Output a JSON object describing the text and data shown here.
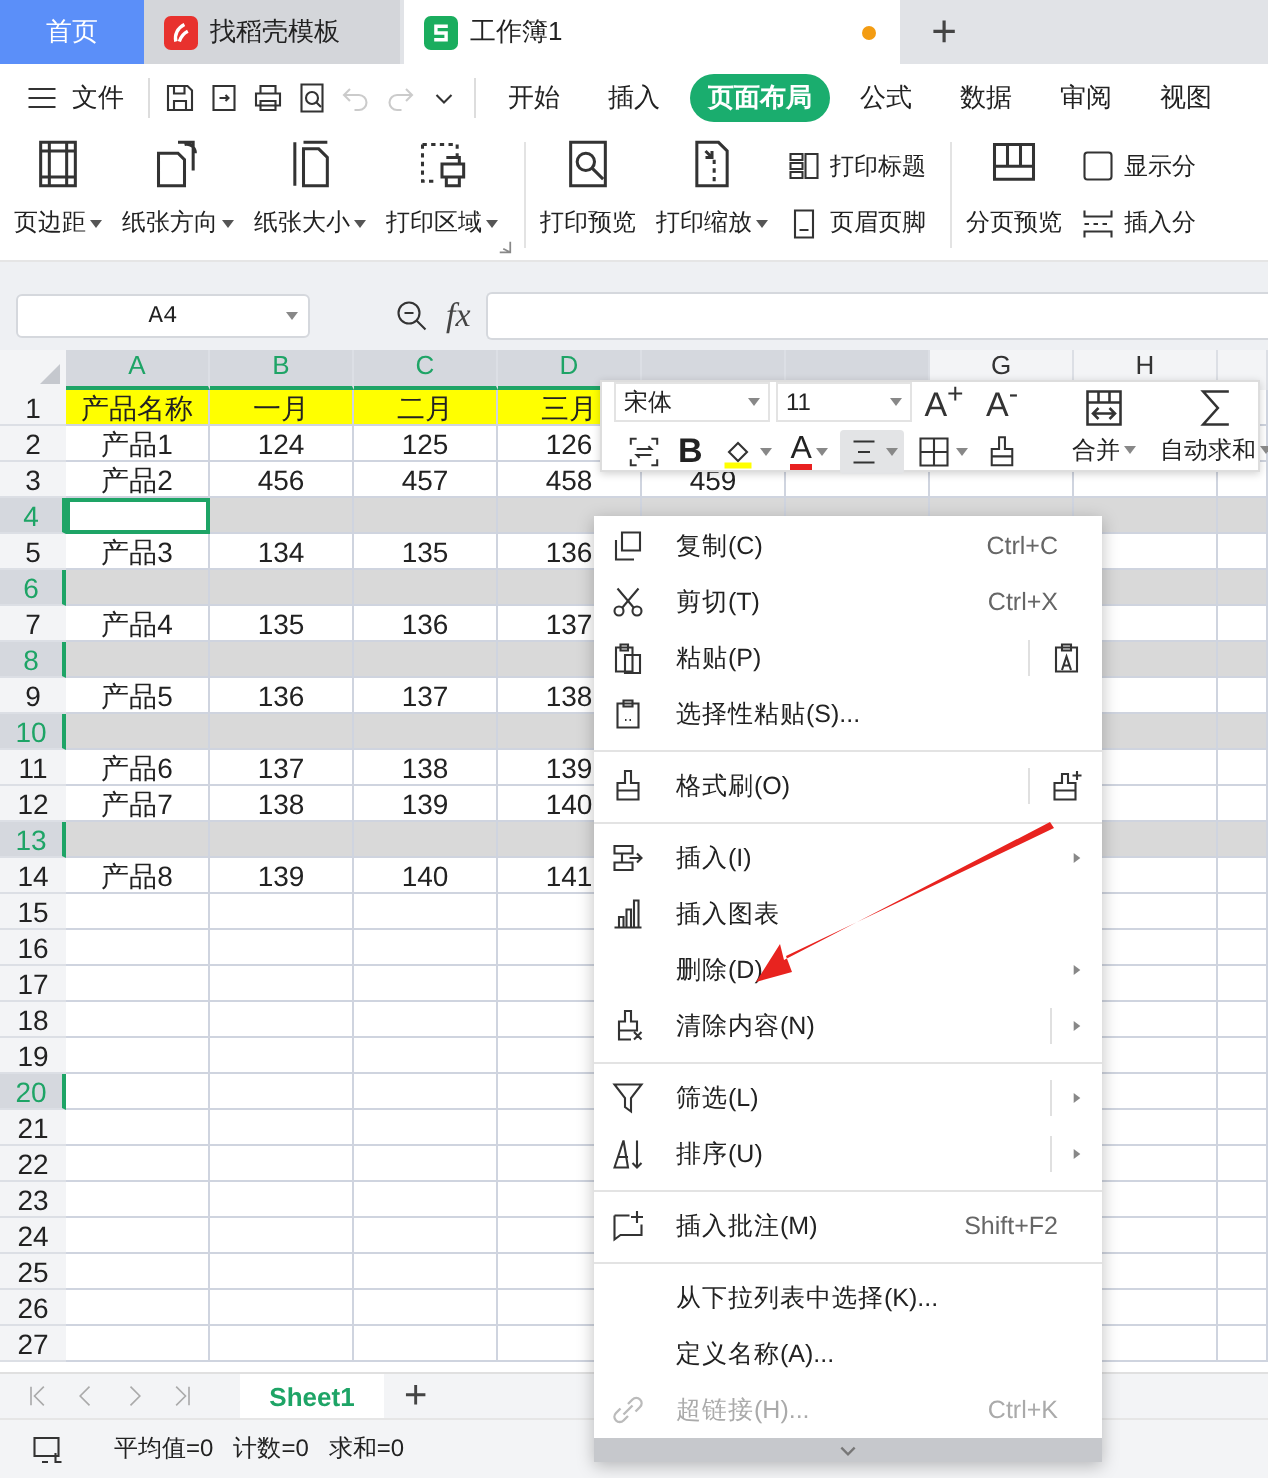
{
  "tabs": [
    {
      "label": "首页",
      "kind": "home",
      "selected": false,
      "unsaved": false
    },
    {
      "label": "找稻壳模板",
      "kind": "template",
      "selected": false,
      "unsaved": false
    },
    {
      "label": "工作簿1",
      "kind": "workbook",
      "selected": true,
      "unsaved": true
    }
  ],
  "new_tab": "+",
  "file_menu": {
    "label": "文件"
  },
  "quick_access": [
    {
      "kind": "save",
      "disabled": false
    },
    {
      "kind": "export",
      "disabled": false
    },
    {
      "kind": "print",
      "disabled": false
    },
    {
      "kind": "preview",
      "disabled": false
    },
    {
      "kind": "undo",
      "disabled": true
    },
    {
      "kind": "redo",
      "disabled": true
    },
    {
      "kind": "more",
      "disabled": false
    }
  ],
  "ribbon_tabs": [
    {
      "label": "开始",
      "selected": false
    },
    {
      "label": "插入",
      "selected": false
    },
    {
      "label": "页面布局",
      "selected": true
    },
    {
      "label": "公式",
      "selected": false
    },
    {
      "label": "数据",
      "selected": false
    },
    {
      "label": "审阅",
      "selected": false
    },
    {
      "label": "视图",
      "selected": false
    }
  ],
  "ribbon_groups": [
    {
      "launcher": true,
      "buttons": [
        {
          "kind": "margins",
          "label": "页边距",
          "dropdown": true
        },
        {
          "kind": "orientation",
          "label": "纸张方向",
          "dropdown": true
        },
        {
          "kind": "size",
          "label": "纸张大小",
          "dropdown": true
        },
        {
          "kind": "area",
          "label": "打印区域",
          "dropdown": true
        }
      ]
    },
    {
      "buttons": [
        {
          "kind": "print-preview",
          "label": "打印预览",
          "dropdown": false
        },
        {
          "kind": "scale",
          "label": "打印缩放",
          "dropdown": true
        }
      ],
      "small_buttons": [
        {
          "kind": "print-titles",
          "label": "打印标题"
        },
        {
          "kind": "header-footer",
          "label": "页眉页脚"
        }
      ]
    },
    {
      "buttons": [
        {
          "kind": "break-preview",
          "label": "分页预览",
          "dropdown": false
        }
      ],
      "small_buttons": [
        {
          "kind": "checkbox",
          "label": "显示分",
          "checked": false
        },
        {
          "kind": "insert-break",
          "label": "插入分"
        }
      ]
    }
  ],
  "name_box": {
    "value": "A4"
  },
  "formula_bar": {
    "function_label": "fx"
  },
  "columns": [
    {
      "label": "A",
      "highlighted": true
    },
    {
      "label": "B",
      "highlighted": true
    },
    {
      "label": "C",
      "highlighted": true
    },
    {
      "label": "D",
      "highlighted": true
    },
    {
      "highlighted": true
    },
    {
      "highlighted": true
    },
    {
      "label": "G",
      "highlighted": false
    },
    {
      "label": "H",
      "highlighted": false
    },
    {
      "highlighted": false
    }
  ],
  "rows": [
    {
      "number": "1",
      "kind": "title",
      "selected": false,
      "active": false,
      "header_highlighted": false,
      "cells": [
        "产品名称",
        "一月",
        "二月",
        "三月"
      ]
    },
    {
      "number": "2",
      "kind": "data",
      "selected": false,
      "active": false,
      "header_highlighted": false,
      "cells": [
        "产品1",
        "124",
        "125",
        "126"
      ]
    },
    {
      "number": "3",
      "kind": "data",
      "selected": false,
      "active": false,
      "header_highlighted": false,
      "cells": [
        "产品2",
        "456",
        "457",
        "458",
        "459"
      ]
    },
    {
      "number": "4",
      "kind": "data",
      "selected": true,
      "active": true,
      "header_highlighted": true
    },
    {
      "number": "5",
      "kind": "data",
      "selected": false,
      "active": false,
      "header_highlighted": false,
      "cells": [
        "产品3",
        "134",
        "135",
        "136"
      ]
    },
    {
      "number": "6",
      "kind": "data",
      "selected": true,
      "active": false,
      "header_highlighted": true
    },
    {
      "number": "7",
      "kind": "data",
      "selected": false,
      "active": false,
      "header_highlighted": false,
      "cells": [
        "产品4",
        "135",
        "136",
        "137"
      ]
    },
    {
      "number": "8",
      "kind": "data",
      "selected": true,
      "active": false,
      "header_highlighted": true
    },
    {
      "number": "9",
      "kind": "data",
      "selected": false,
      "active": false,
      "header_highlighted": false,
      "cells": [
        "产品5",
        "136",
        "137",
        "138"
      ]
    },
    {
      "number": "10",
      "kind": "data",
      "selected": true,
      "active": false,
      "header_highlighted": true
    },
    {
      "number": "11",
      "kind": "data",
      "selected": false,
      "active": false,
      "header_highlighted": false,
      "cells": [
        "产品6",
        "137",
        "138",
        "139"
      ]
    },
    {
      "number": "12",
      "kind": "data",
      "selected": false,
      "active": false,
      "header_highlighted": false,
      "cells": [
        "产品7",
        "138",
        "139",
        "140"
      ]
    },
    {
      "number": "13",
      "kind": "data",
      "selected": true,
      "active": false,
      "header_highlighted": true
    },
    {
      "number": "14",
      "kind": "data",
      "selected": false,
      "active": false,
      "header_highlighted": false,
      "cells": [
        "产品8",
        "139",
        "140",
        "141"
      ]
    },
    {
      "number": "15",
      "kind": "data",
      "selected": false,
      "active": false,
      "header_highlighted": false
    },
    {
      "number": "16",
      "kind": "data",
      "selected": false,
      "active": false,
      "header_highlighted": false
    },
    {
      "number": "17",
      "kind": "data",
      "selected": false,
      "active": false,
      "header_highlighted": false
    },
    {
      "number": "18",
      "kind": "data",
      "selected": false,
      "active": false,
      "header_highlighted": false
    },
    {
      "number": "19",
      "kind": "data",
      "selected": false,
      "active": false,
      "header_highlighted": false
    },
    {
      "number": "20",
      "kind": "data",
      "selected": false,
      "active": false,
      "header_highlighted": true
    },
    {
      "number": "21",
      "kind": "data",
      "selected": false,
      "active": false,
      "header_highlighted": false
    },
    {
      "number": "22",
      "kind": "data",
      "selected": false,
      "active": false,
      "header_highlighted": false
    },
    {
      "number": "23",
      "kind": "data",
      "selected": false,
      "active": false,
      "header_highlighted": false
    },
    {
      "number": "24",
      "kind": "data",
      "selected": false,
      "active": false,
      "header_highlighted": false
    },
    {
      "number": "25",
      "kind": "data",
      "selected": false,
      "active": false,
      "header_highlighted": false
    },
    {
      "number": "26",
      "kind": "data",
      "selected": false,
      "active": false,
      "header_highlighted": false
    },
    {
      "number": "27",
      "kind": "data",
      "selected": false,
      "active": false,
      "header_highlighted": false
    }
  ],
  "mini_toolbar": {
    "font": "宋体",
    "size": "11",
    "grow_label": "A$^{+}$",
    "shrink_label": "A$^{-}$",
    "tools": [
      {
        "kind": "convert",
        "dropdown": false,
        "pressed": false
      },
      {
        "kind": "bold",
        "label": "B",
        "dropdown": false,
        "pressed": false
      },
      {
        "kind": "fill",
        "dropdown": true,
        "pressed": false
      },
      {
        "kind": "font-color",
        "label": "A",
        "dropdown": true,
        "pressed": false
      },
      {
        "kind": "align",
        "dropdown": true,
        "pressed": true
      },
      {
        "kind": "borders",
        "dropdown": true,
        "pressed": false
      },
      {
        "kind": "painter",
        "dropdown": false,
        "pressed": false
      }
    ],
    "large": [
      {
        "kind": "merge",
        "label": "合并",
        "dropdown": true
      },
      {
        "kind": "autosum",
        "label": "自动求和",
        "dropdown": true
      }
    ]
  },
  "context_menu": {
    "items": [
      {
        "kind": "copy",
        "label": "复制(C)",
        "shortcut": "Ctrl+C",
        "submenu": false,
        "split": false,
        "disabled": false
      },
      {
        "kind": "cut",
        "label": "剪切(T)",
        "shortcut": "Ctrl+X",
        "submenu": false,
        "split": false,
        "disabled": false
      },
      {
        "kind": "paste",
        "label": "粘贴(P)",
        "submenu": false,
        "split": true,
        "disabled": false
      },
      {
        "kind": "paste-special",
        "label": "选择性粘贴(S)...",
        "submenu": false,
        "split": false,
        "disabled": false
      },
      {
        "kind": "separator"
      },
      {
        "kind": "format-painter",
        "label": "格式刷(O)",
        "submenu": false,
        "split": true,
        "disabled": false
      },
      {
        "kind": "separator"
      },
      {
        "kind": "insert",
        "label": "插入(I)",
        "submenu": true,
        "split": false,
        "disabled": false
      },
      {
        "kind": "chart",
        "label": "插入图表",
        "submenu": false,
        "split": false,
        "disabled": false
      },
      {
        "kind": "delete",
        "label": "删除(D)",
        "submenu": true,
        "split": false,
        "disabled": false
      },
      {
        "kind": "clear",
        "label": "清除内容(N)",
        "submenu": true,
        "split": true,
        "disabled": false
      },
      {
        "kind": "separator"
      },
      {
        "kind": "filter",
        "label": "筛选(L)",
        "submenu": true,
        "split": true,
        "disabled": false
      },
      {
        "kind": "sort",
        "label": "排序(U)",
        "submenu": true,
        "split": true,
        "disabled": false
      },
      {
        "kind": "separator"
      },
      {
        "kind": "comment",
        "label": "插入批注(M)",
        "shortcut": "Shift+F2",
        "submenu": false,
        "split": false,
        "disabled": false
      },
      {
        "kind": "separator"
      },
      {
        "kind": "pick",
        "label": "从下拉列表中选择(K)...",
        "submenu": false,
        "split": false,
        "disabled": false
      },
      {
        "kind": "define",
        "label": "定义名称(A)...",
        "submenu": false,
        "split": false,
        "disabled": false
      },
      {
        "kind": "link",
        "label": "超链接(H)...",
        "shortcut": "Ctrl+K",
        "submenu": false,
        "split": false,
        "disabled": true
      }
    ]
  },
  "sheet_tabs": [
    {
      "label": "Sheet1",
      "selected": true
    }
  ],
  "new_sheet": "+",
  "status_bar": {
    "stats": [
      "平均值=0",
      "计数=0",
      "求和=0"
    ]
  }
}
